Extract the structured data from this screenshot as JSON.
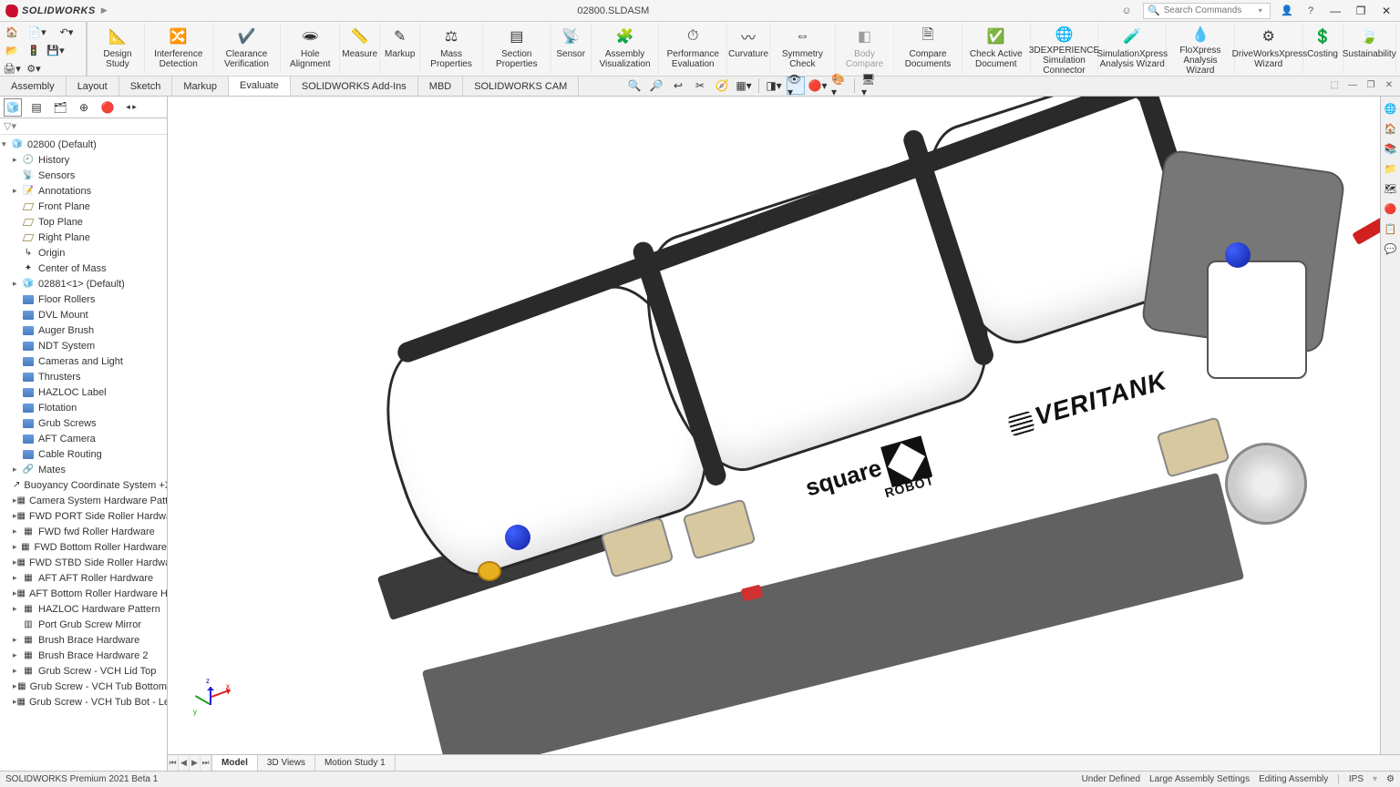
{
  "app": {
    "brand": "SOLIDWORKS",
    "document": "02800.SLDASM",
    "search_placeholder": "Search Commands"
  },
  "ribbon": [
    {
      "label": "Design\nStudy",
      "icon": "📐"
    },
    {
      "label": "Interference\nDetection",
      "icon": "🔀"
    },
    {
      "label": "Clearance\nVerification",
      "icon": "✔️"
    },
    {
      "label": "Hole\nAlignment",
      "icon": "🕳"
    },
    {
      "label": "Measure",
      "icon": "📏"
    },
    {
      "label": "Markup",
      "icon": "✎"
    },
    {
      "label": "Mass\nProperties",
      "icon": "⚖"
    },
    {
      "label": "Section\nProperties",
      "icon": "▤"
    },
    {
      "label": "Sensor",
      "icon": "📡"
    },
    {
      "label": "Assembly\nVisualization",
      "icon": "🧩"
    },
    {
      "label": "Performance\nEvaluation",
      "icon": "⏱"
    },
    {
      "label": "Curvature",
      "icon": "〰"
    },
    {
      "label": "Symmetry\nCheck",
      "icon": "⇔"
    },
    {
      "label": "Body\nCompare",
      "icon": "◧",
      "disabled": true
    },
    {
      "label": "Compare\nDocuments",
      "icon": "🗎"
    },
    {
      "label": "Check Active\nDocument",
      "icon": "✅"
    },
    {
      "label": "3DEXPERIENCE\nSimulation\nConnector",
      "icon": "🌐"
    },
    {
      "label": "SimulationXpress\nAnalysis Wizard",
      "icon": "🧪"
    },
    {
      "label": "FloXpress\nAnalysis\nWizard",
      "icon": "💧"
    },
    {
      "label": "DriveWorksXpress\nWizard",
      "icon": "⚙"
    },
    {
      "label": "Costing",
      "icon": "💲"
    },
    {
      "label": "Sustainability",
      "icon": "🍃"
    }
  ],
  "tabs": [
    {
      "label": "Assembly"
    },
    {
      "label": "Layout"
    },
    {
      "label": "Sketch"
    },
    {
      "label": "Markup"
    },
    {
      "label": "Evaluate",
      "active": true
    },
    {
      "label": "SOLIDWORKS Add-Ins"
    },
    {
      "label": "MBD"
    },
    {
      "label": "SOLIDWORKS CAM"
    }
  ],
  "fm_root": "02800  (Default)",
  "tree": [
    {
      "icon": "history",
      "label": "History",
      "exp": "▸"
    },
    {
      "icon": "sensor",
      "label": "Sensors"
    },
    {
      "icon": "anno",
      "label": "Annotations",
      "exp": "▸"
    },
    {
      "icon": "plane",
      "label": "Front Plane"
    },
    {
      "icon": "plane",
      "label": "Top Plane"
    },
    {
      "icon": "plane",
      "label": "Right Plane"
    },
    {
      "icon": "origin",
      "label": "Origin"
    },
    {
      "icon": "com",
      "label": "Center of Mass"
    },
    {
      "icon": "asm",
      "label": "02881<1> (Default)",
      "exp": "▸"
    },
    {
      "icon": "folder",
      "label": "Floor Rollers"
    },
    {
      "icon": "folder",
      "label": "DVL Mount"
    },
    {
      "icon": "folder",
      "label": "Auger Brush"
    },
    {
      "icon": "folder",
      "label": "NDT System"
    },
    {
      "icon": "folder",
      "label": "Cameras and Light"
    },
    {
      "icon": "folder",
      "label": "Thrusters"
    },
    {
      "icon": "folder",
      "label": "HAZLOC Label"
    },
    {
      "icon": "folder",
      "label": "Flotation"
    },
    {
      "icon": "folder",
      "label": "Grub Screws"
    },
    {
      "icon": "folder",
      "label": "AFT Camera"
    },
    {
      "icon": "folder",
      "label": "Cable Routing"
    },
    {
      "icon": "mates",
      "label": "Mates",
      "exp": "▸"
    },
    {
      "icon": "csys",
      "label": "Buoyancy Coordinate System +X"
    },
    {
      "icon": "pattern",
      "label": "Camera System Hardware Pattern",
      "exp": "▸"
    },
    {
      "icon": "pattern",
      "label": "FWD PORT Side Roller Hardware",
      "exp": "▸"
    },
    {
      "icon": "pattern",
      "label": "FWD fwd Roller Hardware",
      "exp": "▸"
    },
    {
      "icon": "pattern",
      "label": "FWD Bottom Roller Hardware",
      "exp": "▸"
    },
    {
      "icon": "pattern",
      "label": "FWD STBD Side Roller Hardware",
      "exp": "▸"
    },
    {
      "icon": "pattern",
      "label": "AFT AFT Roller Hardware",
      "exp": "▸"
    },
    {
      "icon": "pattern",
      "label": "AFT Bottom Roller Hardware HD",
      "exp": "▸"
    },
    {
      "icon": "pattern",
      "label": "HAZLOC Hardware Pattern",
      "exp": "▸"
    },
    {
      "icon": "mirror",
      "label": "Port Grub Screw Mirror"
    },
    {
      "icon": "pattern",
      "label": "Brush Brace Hardware",
      "exp": "▸"
    },
    {
      "icon": "pattern",
      "label": "Brush Brace Hardware 2",
      "exp": "▸"
    },
    {
      "icon": "pattern",
      "label": "Grub Screw - VCH Lid Top",
      "exp": "▸"
    },
    {
      "icon": "pattern",
      "label": "Grub Screw - VCH Tub Bottom",
      "exp": "▸"
    },
    {
      "icon": "pattern",
      "label": "Grub Screw - VCH Tub Bot - Legs",
      "exp": "▸"
    }
  ],
  "decals": {
    "square_robot_top": "square",
    "square_robot_sub": "ROBOT",
    "veritank": "VERITANK"
  },
  "bottom_tabs": [
    {
      "label": "Model",
      "active": true
    },
    {
      "label": "3D Views"
    },
    {
      "label": "Motion Study 1"
    }
  ],
  "status": {
    "left": "SOLIDWORKS Premium 2021 Beta 1",
    "under_defined": "Under Defined",
    "large_asm": "Large Assembly Settings",
    "editing": "Editing Assembly",
    "units": "IPS"
  }
}
